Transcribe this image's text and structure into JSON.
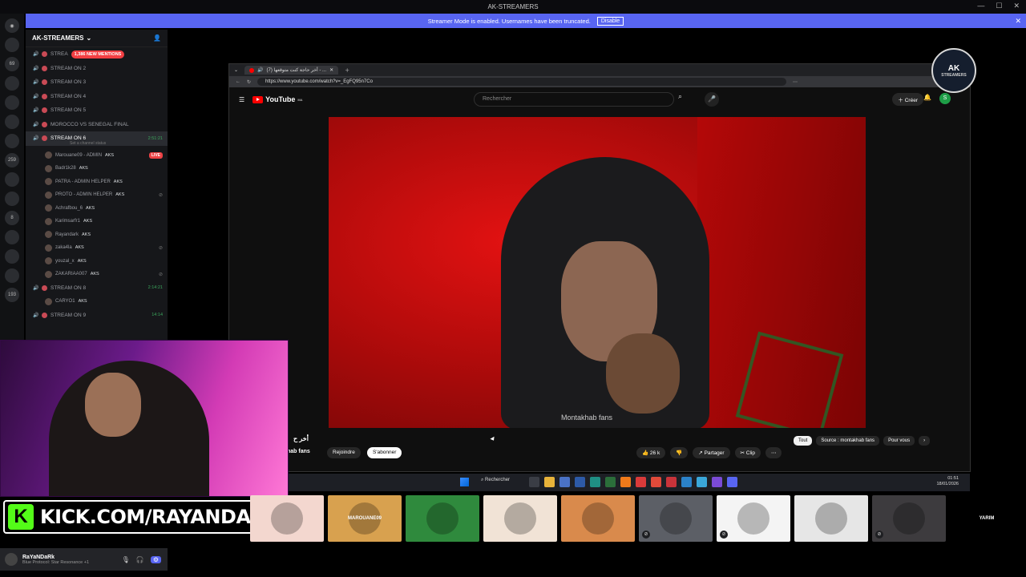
{
  "window": {
    "title": "AK-STREAMERS"
  },
  "banner": {
    "text": "Streamer Mode is enabled. Usernames have been truncated.",
    "button": "Disable"
  },
  "server_badges": [
    "69",
    "259",
    "8",
    "193"
  ],
  "guild": {
    "name": "AK-STREAMERS"
  },
  "channels": [
    {
      "label": "STREA",
      "mention": "1,386 NEW MENTIONS"
    },
    {
      "label": "STREAM ON 2"
    },
    {
      "label": "STREAM ON 3"
    },
    {
      "label": "STREAM ON 4"
    },
    {
      "label": "STREAM ON 5"
    },
    {
      "label": "MOROCCO VS SENEGAL FINAL"
    },
    {
      "label": "STREAM ON 6",
      "timer": "2:51:21",
      "status": "Set a channel status"
    }
  ],
  "voice_users": [
    {
      "name": "Marouane09 - ADMIN",
      "tag": "AKS",
      "live": "LIVE"
    },
    {
      "name": "Badr1k28",
      "tag": "AKS"
    },
    {
      "name": "PATRA - ADMIN HELPER",
      "tag": "AKS"
    },
    {
      "name": "PROTO - ADMIN HELPER",
      "tag": "AKS"
    },
    {
      "name": "Achrafbou_6",
      "tag": "AKS"
    },
    {
      "name": "Karimsarfr1",
      "tag": "AKS"
    },
    {
      "name": "Rayandark",
      "tag": "AKS"
    },
    {
      "name": "zaka4la",
      "tag": "AKS"
    },
    {
      "name": "youzal_x",
      "tag": "AKS"
    },
    {
      "name": "ZAKARIAA007",
      "tag": "AKS"
    }
  ],
  "channels_lower": [
    {
      "label": "STREAM ON 8",
      "timer": "2:14:21",
      "user": "CARYO1",
      "tag": "AKS"
    },
    {
      "label": "STREAM ON 9",
      "timer": "14:14"
    }
  ],
  "browser": {
    "tab_title": "أخر حاجة كنت متوقعها (7) - ...",
    "url": "https://www.youtube.com/watch?v=_EgFQ95n7Co"
  },
  "youtube": {
    "logo": "YouTube",
    "logo_sup": "MA",
    "search_placeholder": "Rechercher",
    "create": "Créer",
    "avatar_letter": "S",
    "video_watermark": "Montakhab fans",
    "title_short": "أخر ح",
    "channel_name": "hab fans",
    "join": "Rejoindre",
    "subscribe": "S'abonner",
    "likes": "26 k",
    "share": "Partager",
    "clip": "Clip",
    "chips": [
      "Tout",
      "Source : montakhab fans",
      "Pour vous"
    ]
  },
  "logo_badge": {
    "main": "AK",
    "sub": "STREAMERS"
  },
  "taskbar": {
    "search": "Rechercher",
    "time": "01:51",
    "date": "18/01/2026"
  },
  "kick": {
    "text": "KICK.COM/RAYANDARK"
  },
  "tiles": [
    {
      "label": "",
      "color": "#f3d7cf"
    },
    {
      "label": "MAROUANE09",
      "color": "#d8a14f"
    },
    {
      "label": "",
      "color": "#2f8a3d"
    },
    {
      "label": "",
      "color": "#f1e3d6"
    },
    {
      "label": "",
      "color": "#d98a4c"
    },
    {
      "label": "",
      "color": "#5c5f66"
    },
    {
      "label": "",
      "color": "#f4f4f4"
    },
    {
      "label": "",
      "color": "#e6e6e6"
    },
    {
      "label": "",
      "color": "#3d3b3e"
    },
    {
      "label": "YARIM",
      "color": "#000000"
    }
  ],
  "user_bar": {
    "name": "RaYaNDaRk",
    "status": "Blue Protocol: Star Resonance +1"
  }
}
